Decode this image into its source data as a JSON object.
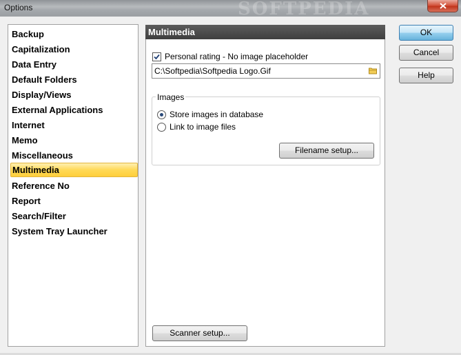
{
  "window": {
    "title": "Options",
    "watermark": "SOFTPEDIA"
  },
  "sidebar": {
    "items": [
      {
        "label": "Backup"
      },
      {
        "label": "Capitalization"
      },
      {
        "label": "Data Entry"
      },
      {
        "label": "Default Folders"
      },
      {
        "label": "Display/Views"
      },
      {
        "label": "External Applications"
      },
      {
        "label": "Internet"
      },
      {
        "label": "Memo"
      },
      {
        "label": "Miscellaneous"
      },
      {
        "label": "Multimedia",
        "selected": true
      },
      {
        "label": "Reference No"
      },
      {
        "label": "Report"
      },
      {
        "label": "Search/Filter"
      },
      {
        "label": "System Tray Launcher"
      }
    ]
  },
  "panel": {
    "header": "Multimedia",
    "personal_rating": {
      "label": "Personal rating - No image placeholder",
      "checked": true
    },
    "path_value": "C:\\Softpedia\\Softpedia Logo.Gif",
    "images_group": {
      "legend": "Images",
      "options": [
        {
          "label": "Store images in database",
          "selected": true
        },
        {
          "label": "Link to image files",
          "selected": false
        }
      ],
      "filename_setup": "Filename setup..."
    },
    "scanner_setup": "Scanner setup..."
  },
  "buttons": {
    "ok": "OK",
    "cancel": "Cancel",
    "help": "Help"
  },
  "icons": [
    "close-icon",
    "folder-icon",
    "checkmark-icon",
    "radio-dot-icon"
  ],
  "colors": {
    "selection": "#ffd957",
    "header_bg": "#4a4a4a",
    "default_button": "#98d1ef",
    "close_button": "#c1351c"
  }
}
